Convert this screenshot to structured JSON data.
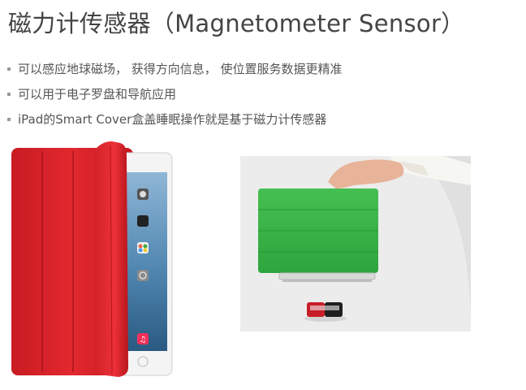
{
  "slide": {
    "title": "磁力计传感器（Magnetometer Sensor）",
    "bullets": [
      "可以感应地球磁场， 获得方向信息， 使位置服务数据更精准",
      "可以用于电子罗盘和导航应用",
      "iPad的Smart Cover盒盖睡眠操作就是基于磁力计传感器"
    ]
  },
  "images": {
    "left": {
      "app_labels": [
        "Camera",
        "Videos",
        "Game Center",
        "Settings"
      ]
    }
  },
  "colors": {
    "cover_red": "#e0242c",
    "cover_green": "#3cb54a",
    "title_text": "#444444",
    "bullet_text": "#555555"
  }
}
